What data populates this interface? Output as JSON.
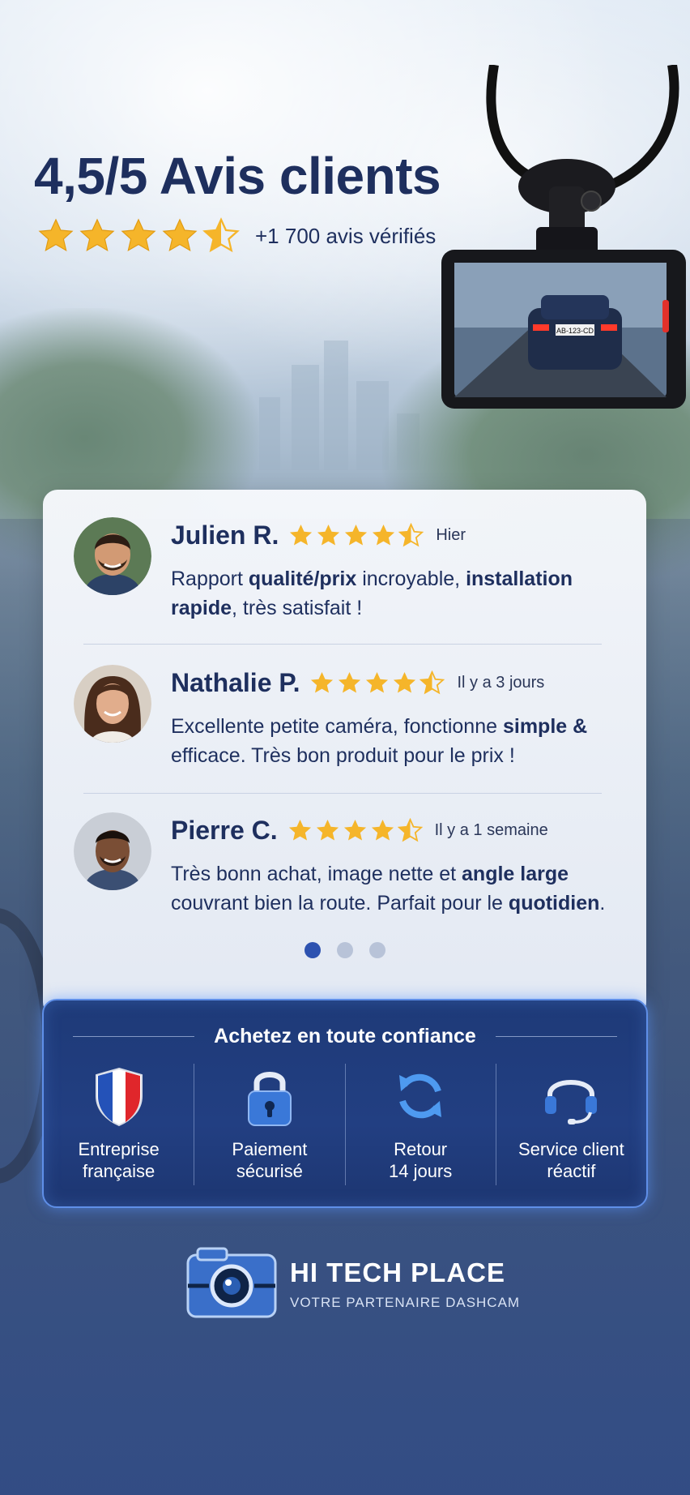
{
  "header": {
    "title": "4,5/5 Avis clients",
    "rating": 4.5,
    "verified_count": "+1 700 avis vérifiés"
  },
  "colors": {
    "star": "#f5b52a",
    "primary": "#1e2f5e",
    "accent": "#2d52b0"
  },
  "reviews": [
    {
      "name": "Julien R.",
      "rating": 4.5,
      "time": "Hier",
      "text_parts": [
        "Rapport ",
        "qualité/prix",
        " incroyable, ",
        "installation rapide",
        ", très satisfait !"
      ],
      "avatar_icon": "man-avatar"
    },
    {
      "name": "Nathalie P.",
      "rating": 4.5,
      "time": "Il y a 3 jours",
      "text_parts": [
        "Excellente petite caméra, fonctionne ",
        "simple &",
        " efficace. Très bon produit pour le prix !"
      ],
      "avatar_icon": "woman-avatar"
    },
    {
      "name": "Pierre C.",
      "rating": 4.5,
      "time": "Il y a 1 semaine",
      "text_parts": [
        "Très bonn achat, image nette et ",
        "angle large",
        " couvrant bien la route. Parfait pour le ",
        "quotidien",
        "."
      ],
      "avatar_icon": "man-avatar"
    }
  ],
  "carousel": {
    "total": 3,
    "active": 1
  },
  "trust": {
    "title": "Achetez en toute confiance",
    "items": [
      {
        "icon": "french-flag-shield-icon",
        "label": "Entreprise\nfrançaise"
      },
      {
        "icon": "padlock-icon",
        "label": "Paiement\nsécurisé"
      },
      {
        "icon": "refresh-arrows-icon",
        "label": "Retour\n14 jours"
      },
      {
        "icon": "headset-icon",
        "label": "Service client\nréactif"
      }
    ]
  },
  "brand": {
    "name": "HI TECH PLACE",
    "tagline": "VOTRE PARTENAIRE DASHCAM",
    "dashcam_plate": "AB-123-CD"
  }
}
